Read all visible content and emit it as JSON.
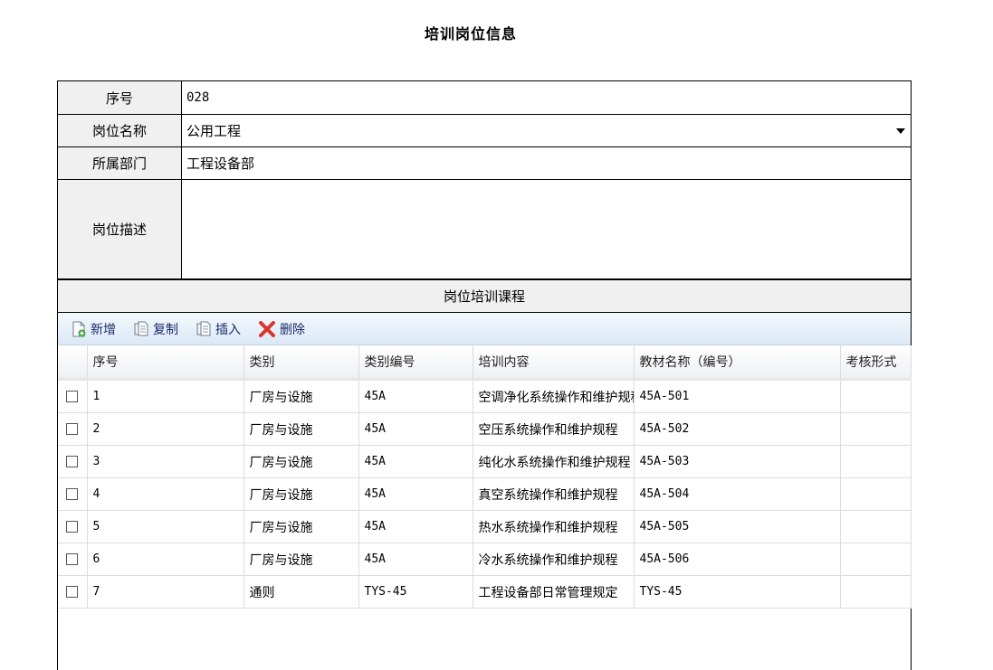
{
  "page": {
    "title": "培训岗位信息"
  },
  "form": {
    "serial_label": "序号",
    "serial_value": "028",
    "position_label": "岗位名称",
    "position_value": "公用工程",
    "dept_label": "所属部门",
    "dept_value": "工程设备部",
    "desc_label": "岗位描述",
    "desc_value": ""
  },
  "courses": {
    "section_title": "岗位培训课程",
    "toolbar": {
      "add": "新增",
      "copy": "复制",
      "insert": "插入",
      "delete": "删除"
    },
    "columns": {
      "no": "序号",
      "category": "类别",
      "code": "类别编号",
      "content": "培训内容",
      "material": "教材名称（编号）",
      "exam": "考核形式"
    },
    "rows": [
      {
        "no": "1",
        "category": "厂房与设施",
        "code": "45A",
        "content": "空调净化系统操作和维护规程",
        "material": "45A-501",
        "exam": ""
      },
      {
        "no": "2",
        "category": "厂房与设施",
        "code": "45A",
        "content": "空压系统操作和维护规程",
        "material": "45A-502",
        "exam": ""
      },
      {
        "no": "3",
        "category": "厂房与设施",
        "code": "45A",
        "content": "纯化水系统操作和维护规程",
        "material": "45A-503",
        "exam": ""
      },
      {
        "no": "4",
        "category": "厂房与设施",
        "code": "45A",
        "content": "真空系统操作和维护规程",
        "material": "45A-504",
        "exam": ""
      },
      {
        "no": "5",
        "category": "厂房与设施",
        "code": "45A",
        "content": "热水系统操作和维护规程",
        "material": "45A-505",
        "exam": ""
      },
      {
        "no": "6",
        "category": "厂房与设施",
        "code": "45A",
        "content": "冷水系统操作和维护规程",
        "material": "45A-506",
        "exam": ""
      },
      {
        "no": "7",
        "category": "通则",
        "code": "TYS-45",
        "content": "工程设备部日常管理规定",
        "material": "TYS-45",
        "exam": ""
      }
    ]
  }
}
